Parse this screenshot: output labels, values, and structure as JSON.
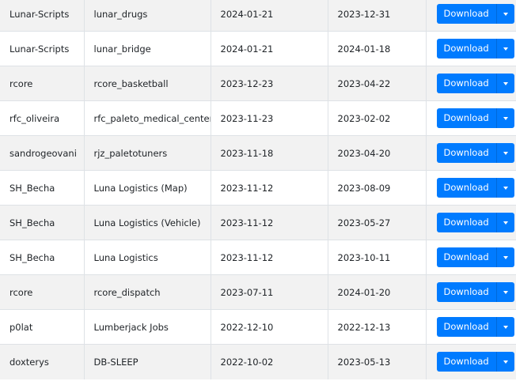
{
  "table": {
    "download_label": "Download",
    "caret_icon": "caret-down-icon",
    "accent_color": "#007bff",
    "stripe_color": "#f2f2f2",
    "rows": [
      {
        "author": "Lunar-Scripts",
        "name": "lunar_drugs",
        "date_added": "2024-01-21",
        "date_updated": "2023-12-31"
      },
      {
        "author": "Lunar-Scripts",
        "name": "lunar_bridge",
        "date_added": "2024-01-21",
        "date_updated": "2024-01-18"
      },
      {
        "author": "rcore",
        "name": "rcore_basketball",
        "date_added": "2023-12-23",
        "date_updated": "2023-04-22"
      },
      {
        "author": "rfc_oliveira",
        "name": "rfc_paleto_medical_center",
        "date_added": "2023-11-23",
        "date_updated": "2023-02-02"
      },
      {
        "author": "sandrogeovani",
        "name": "rjz_paletotuners",
        "date_added": "2023-11-18",
        "date_updated": "2023-04-20"
      },
      {
        "author": "SH_Becha",
        "name": "Luna Logistics (Map)",
        "date_added": "2023-11-12",
        "date_updated": "2023-08-09"
      },
      {
        "author": "SH_Becha",
        "name": "Luna Logistics (Vehicle)",
        "date_added": "2023-11-12",
        "date_updated": "2023-05-27"
      },
      {
        "author": "SH_Becha",
        "name": "Luna Logistics",
        "date_added": "2023-11-12",
        "date_updated": "2023-10-11"
      },
      {
        "author": "rcore",
        "name": "rcore_dispatch",
        "date_added": "2023-07-11",
        "date_updated": "2024-01-20"
      },
      {
        "author": "p0lat",
        "name": "Lumberjack Jobs",
        "date_added": "2022-12-10",
        "date_updated": "2022-12-13"
      },
      {
        "author": "doxterys",
        "name": "DB-SLEEP",
        "date_added": "2022-10-02",
        "date_updated": "2023-05-13"
      }
    ]
  }
}
